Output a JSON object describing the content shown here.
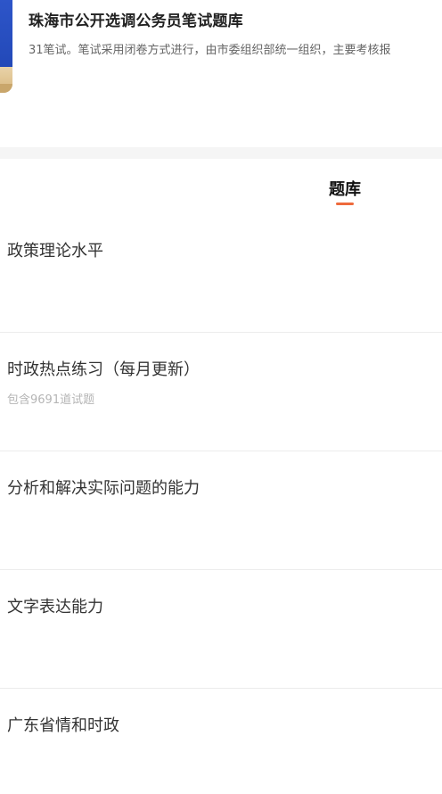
{
  "course": {
    "title": "珠海市公开选调公务员笔试题库",
    "description": "31笔试。笔试采用闭卷方式进行，由市委组织部统一组织，主要考核报"
  },
  "tabs": [
    {
      "label": "题库",
      "active": true
    }
  ],
  "accent_color": "#ee6a3c",
  "question_banks": [
    {
      "name": "政策理论水平",
      "subtitle": ""
    },
    {
      "name": "时政热点练习（每月更新）",
      "subtitle": "包含9691道试题"
    },
    {
      "name": "分析和解决实际问题的能力",
      "subtitle": ""
    },
    {
      "name": "文字表达能力",
      "subtitle": ""
    },
    {
      "name": "广东省情和时政",
      "subtitle": ""
    }
  ]
}
